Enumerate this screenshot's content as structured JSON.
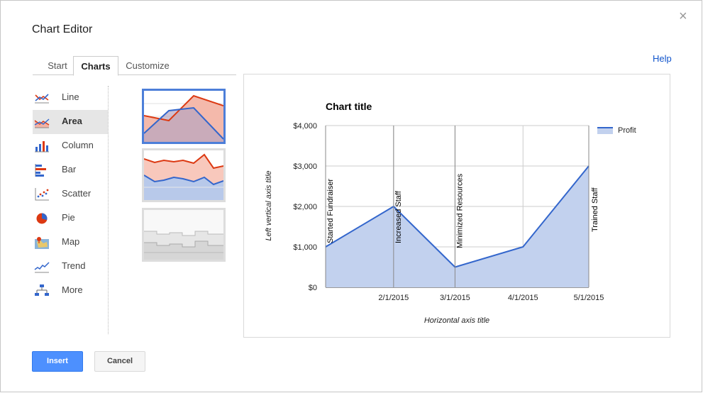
{
  "dialog": {
    "title": "Chart Editor",
    "help_label": "Help",
    "close_glyph": "×"
  },
  "tabs": [
    {
      "label": "Start"
    },
    {
      "label": "Charts"
    },
    {
      "label": "Customize"
    }
  ],
  "selected_tab": "Charts",
  "chart_types": [
    {
      "label": "Line",
      "icon": "line-chart-icon"
    },
    {
      "label": "Area",
      "icon": "area-chart-icon"
    },
    {
      "label": "Column",
      "icon": "column-chart-icon"
    },
    {
      "label": "Bar",
      "icon": "bar-chart-icon"
    },
    {
      "label": "Scatter",
      "icon": "scatter-chart-icon"
    },
    {
      "label": "Pie",
      "icon": "pie-chart-icon"
    },
    {
      "label": "Map",
      "icon": "map-chart-icon"
    },
    {
      "label": "Trend",
      "icon": "trend-chart-icon"
    },
    {
      "label": "More",
      "icon": "org-chart-icon"
    }
  ],
  "selected_chart_type": "Area",
  "buttons": {
    "insert": "Insert",
    "cancel": "Cancel"
  },
  "colors": {
    "accent_blue": "#4d90fe",
    "series_blue": "#3366cc",
    "series_red": "#dc3912",
    "area_fill": "#c2d1ee",
    "link": "#1155cc"
  },
  "chart_data": {
    "type": "area",
    "title": "Chart title",
    "xlabel": "Horizontal axis title",
    "ylabel": "Left vertical axis title",
    "x_ticks": [
      "2/1/2015",
      "3/1/2015",
      "4/1/2015",
      "5/1/2015"
    ],
    "y_ticks": [
      "$0",
      "$1,000",
      "$2,000",
      "$3,000",
      "$4,000"
    ],
    "ylim": [
      0,
      4000
    ],
    "xlim": [
      "1/1/2015",
      "5/1/2015"
    ],
    "series": [
      {
        "name": "Profit",
        "x": [
          "1/1/2015",
          "2/1/2015",
          "3/1/2015",
          "4/1/2015",
          "5/1/2015"
        ],
        "values": [
          1000,
          2000,
          500,
          1000,
          3000
        ]
      }
    ],
    "annotations": [
      {
        "x": "1/1/2015",
        "text": "Started Fundraiser"
      },
      {
        "x": "2/1/2015",
        "text": "Increased Staff"
      },
      {
        "x": "3/1/2015",
        "text": "Minimized Resources"
      },
      {
        "x": "5/1/2015",
        "text": "Trained Staff"
      }
    ],
    "legend": "right",
    "grid": true
  }
}
